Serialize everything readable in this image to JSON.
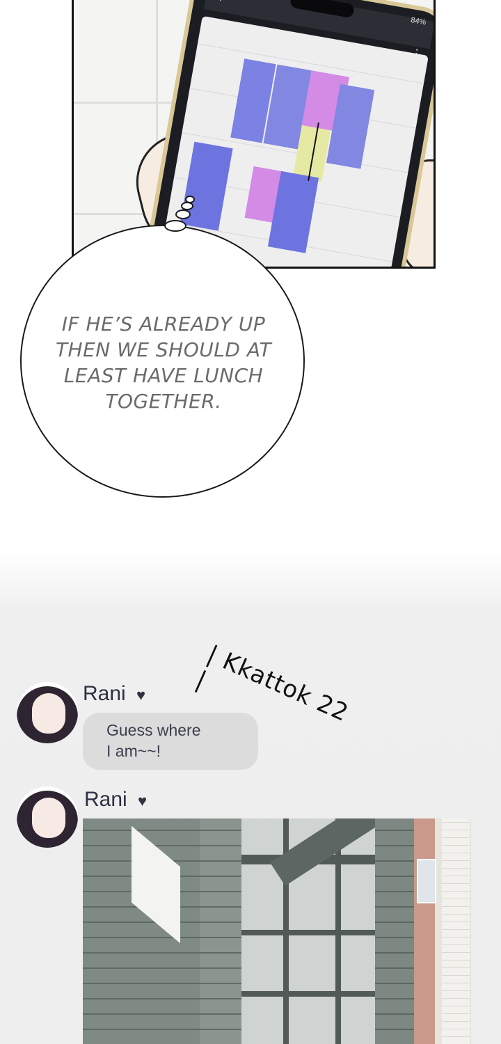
{
  "phone": {
    "status": "84%",
    "back_icon": "chevron-left-icon",
    "menu_icon": "kebab-menu-icon",
    "calendar_colors": {
      "blue": "#7b82e3",
      "purple": "#d38be6",
      "yellow": "#e6e9a3"
    }
  },
  "thought": {
    "text": "If he’s already up then we should at least have lunch together."
  },
  "sfx": {
    "text": "| Kkattok 22 |"
  },
  "chat": {
    "messages": [
      {
        "sender": "Rani",
        "text_line1": "Guess where",
        "text_line2": "I am~~!"
      },
      {
        "sender": "Rani",
        "attachment": "building photo"
      }
    ]
  }
}
